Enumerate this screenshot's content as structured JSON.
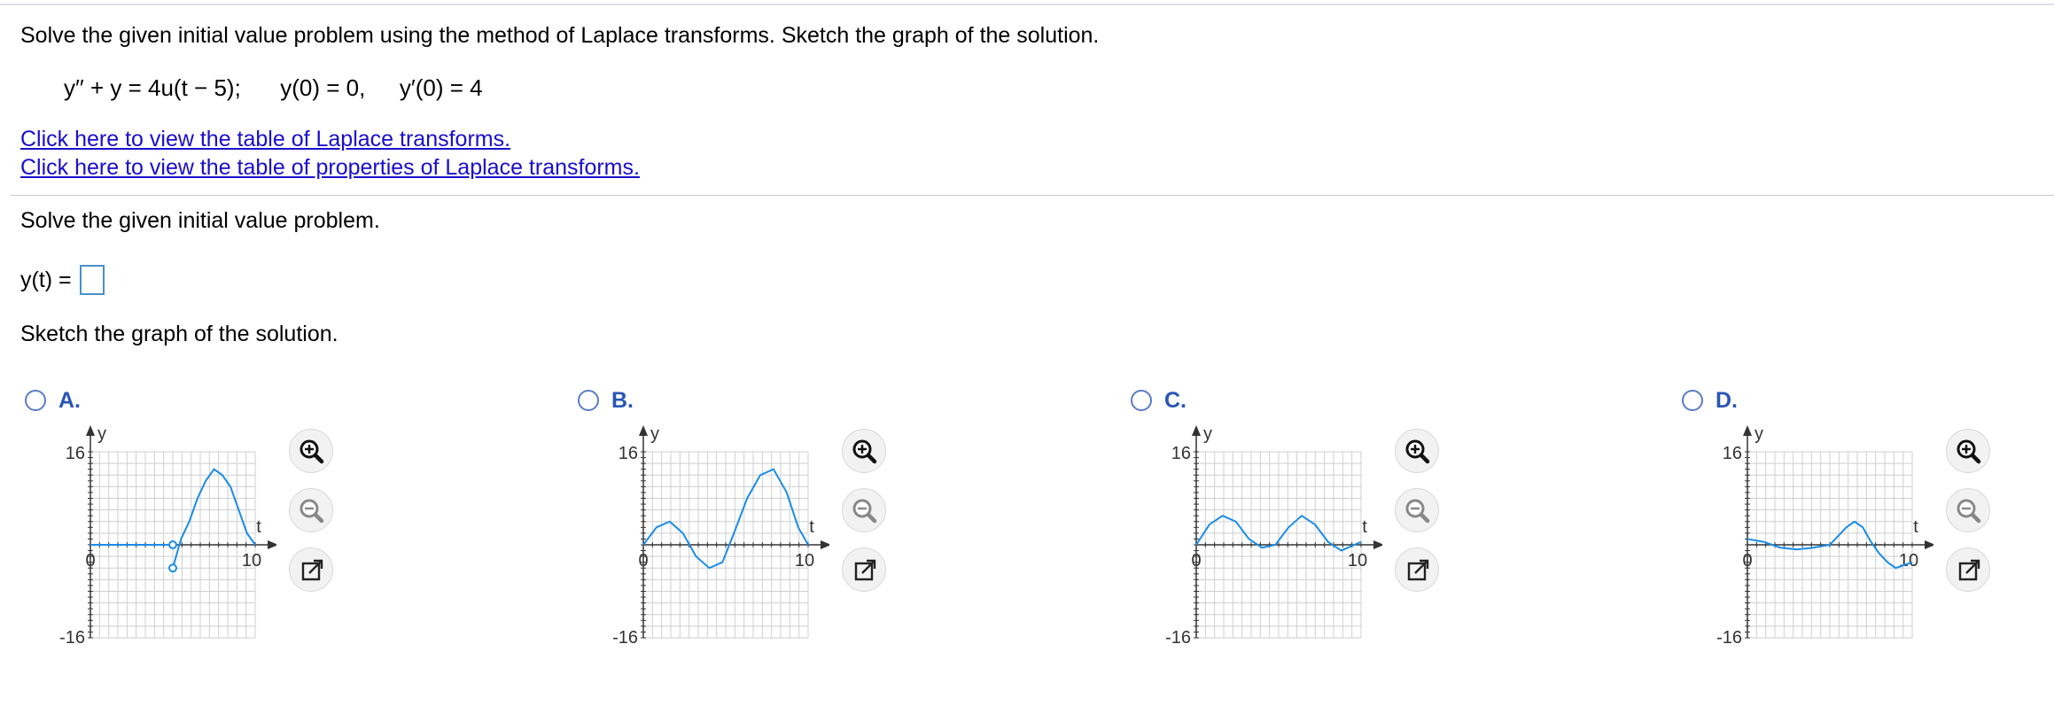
{
  "problem": {
    "instruction": "Solve the given initial value problem using the method of Laplace transforms. Sketch the graph of the solution.",
    "equation": {
      "de_left": "y′′ + y = 4u(t − 5);",
      "ic1": "y(0) = 0,",
      "ic2": "y′(0) = 4"
    },
    "links": [
      "Click here to view the table of Laplace transforms.",
      "Click here to view the table of properties of Laplace transforms."
    ]
  },
  "part1": {
    "prompt": "Solve the given initial value problem.",
    "answer_label": "y(t) =",
    "answer_value": ""
  },
  "part2": {
    "prompt": "Sketch the graph of the solution."
  },
  "options": [
    {
      "letter": "A.",
      "selected": false
    },
    {
      "letter": "B.",
      "selected": false
    },
    {
      "letter": "C.",
      "selected": false
    },
    {
      "letter": "D.",
      "selected": false
    }
  ],
  "axis_labels": {
    "y": "y",
    "x": "t",
    "ytop": "16",
    "ybottom": "-16",
    "origin": "0",
    "xtick": "10"
  },
  "colors": {
    "curve": "#1a8ce8",
    "grid": "#cfcfcf",
    "link": "#1a0dcc",
    "option_label": "#2a55b5"
  },
  "tool_icons": [
    "zoom-in-icon",
    "zoom-out-icon",
    "open-external-icon"
  ],
  "chart_data": [
    {
      "type": "line",
      "option": "A.",
      "xlabel": "t",
      "ylabel": "y",
      "xlim": [
        0,
        10
      ],
      "ylim": [
        -16,
        16
      ],
      "x": [
        0,
        1,
        2,
        3,
        4,
        5,
        5.5,
        6,
        6.5,
        7,
        7.5,
        8,
        8.5,
        9,
        9.5,
        10
      ],
      "y": [
        0,
        0,
        0,
        0,
        0,
        0,
        1,
        4,
        8,
        11,
        13,
        12,
        10,
        6,
        2,
        0
      ],
      "discontinuity": {
        "t": 5,
        "open_points": [
          0,
          -4
        ]
      }
    },
    {
      "type": "line",
      "option": "B.",
      "xlabel": "t",
      "ylabel": "y",
      "xlim": [
        0,
        10
      ],
      "ylim": [
        -16,
        16
      ],
      "x": [
        0,
        0.8,
        1.6,
        2.4,
        3.2,
        4.0,
        4.8,
        5.5,
        6.3,
        7.1,
        7.9,
        8.7,
        9.4,
        10
      ],
      "y": [
        0,
        3,
        4,
        2,
        -2,
        -4,
        -3,
        2,
        8,
        12,
        13,
        9,
        3,
        0
      ]
    },
    {
      "type": "line",
      "option": "C.",
      "xlabel": "t",
      "ylabel": "y",
      "xlim": [
        0,
        10
      ],
      "ylim": [
        -16,
        16
      ],
      "x": [
        0,
        0.8,
        1.6,
        2.4,
        3.2,
        4.0,
        4.8,
        5.6,
        6.4,
        7.2,
        8.0,
        8.8,
        9.6,
        10
      ],
      "y": [
        0,
        3.5,
        5,
        4,
        1,
        -0.5,
        0,
        3,
        5,
        3.5,
        0.5,
        -1,
        0,
        0.5
      ]
    },
    {
      "type": "line",
      "option": "D.",
      "xlabel": "t",
      "ylabel": "y",
      "xlim": [
        0,
        10
      ],
      "ylim": [
        -16,
        16
      ],
      "x": [
        0,
        1,
        2,
        3,
        4,
        5,
        5.5,
        6,
        6.5,
        7,
        7.5,
        8,
        8.5,
        9,
        9.5,
        10
      ],
      "y": [
        1,
        0.5,
        -0.5,
        -0.8,
        -0.5,
        0,
        1.5,
        3,
        4,
        3,
        0.5,
        -1.5,
        -3,
        -4,
        -3.5,
        -3
      ]
    }
  ]
}
